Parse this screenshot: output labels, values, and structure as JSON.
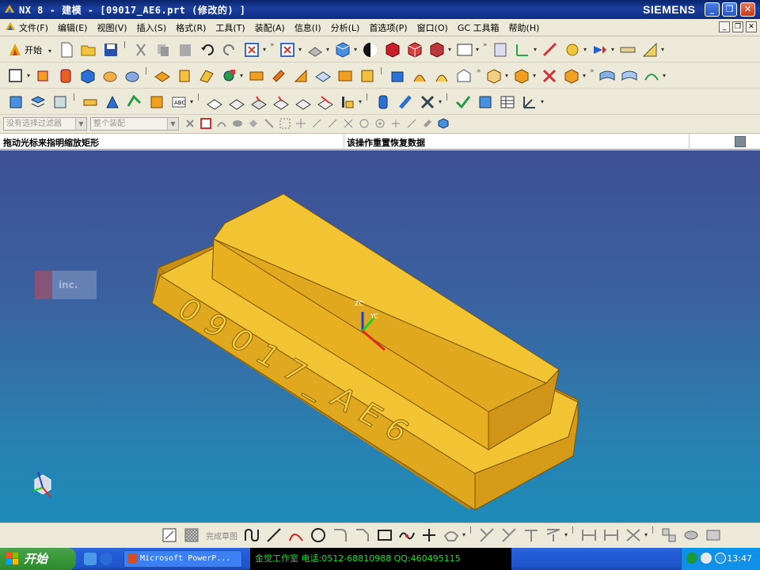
{
  "window": {
    "title": "NX 8 - 建模 - [09017_AE6.prt  (修改的) ]",
    "brand": "SIEMENS",
    "buttons": {
      "minimize": "_",
      "maximize": "❐",
      "close": "✕"
    }
  },
  "menubar": {
    "items": [
      "文件(F)",
      "编辑(E)",
      "视图(V)",
      "插入(S)",
      "格式(R)",
      "工具(T)",
      "装配(A)",
      "信息(I)",
      "分析(L)",
      "首选项(P)",
      "窗口(O)",
      "GC 工具箱",
      "帮助(H)"
    ],
    "mdi_buttons": [
      "_",
      "❐",
      "✕"
    ]
  },
  "toolbar1": {
    "start_label": "开始"
  },
  "selection_bar": {
    "filter_placeholder": "没有选择过滤器",
    "scope_placeholder": "整个装配"
  },
  "cue_line": {
    "left": "拖动光标来指明缩放矩形",
    "right": "该操作重置恢复数据"
  },
  "model": {
    "engraved_text": "09017_AE6",
    "colors": {
      "face_top": "#f2c433",
      "face_side": "#e0a81f",
      "face_dark": "#c98f14",
      "edge": "#7a5600"
    },
    "csys": {
      "zc": "ZC",
      "yc": "YC"
    },
    "watermark_text": "inc."
  },
  "sketch_bar": {
    "finish_label": "完成草图"
  },
  "taskbar": {
    "start": "开始",
    "task_item": "Microsoft PowerP...",
    "banner": "金觉工作室 电话:0512-68810988 QQ:460495115",
    "clock": "13:47"
  },
  "colors": {
    "titlebar": "#0a246a",
    "viewport_top": "#3e4f96",
    "viewport_bottom": "#1d8bb8",
    "banner_text": "#16e028"
  }
}
